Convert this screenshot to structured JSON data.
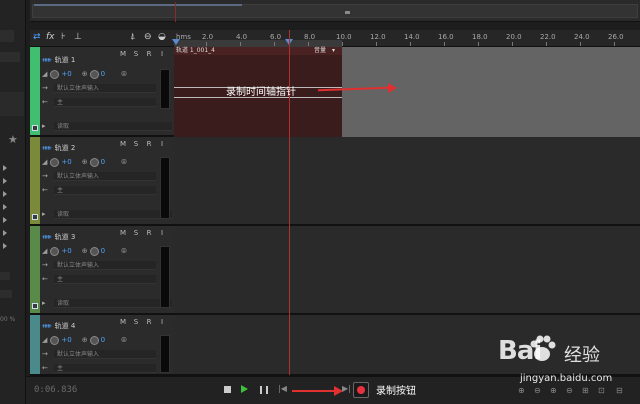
{
  "left_panel": {
    "percent_label": "00 %"
  },
  "toolbar": {
    "fx_label": "fx"
  },
  "ruler": {
    "unit": "hms",
    "ticks": [
      "2.0",
      "4.0",
      "6.0",
      "8.0",
      "10.0",
      "12.0",
      "14.0",
      "16.0",
      "18.0",
      "20.0",
      "22.0",
      "24.0",
      "26.0"
    ]
  },
  "track_labels": {
    "mute": "M",
    "solo": "S",
    "record": "R",
    "input": "I",
    "volume_value": "+0",
    "pan_value": "0",
    "input_placeholder": "默认立体声输入",
    "output": "主",
    "read_mode": "读取"
  },
  "tracks": [
    {
      "name": "轨道 1",
      "color": "#3fbf6f"
    },
    {
      "name": "轨道 2",
      "color": "#7a8a3a"
    },
    {
      "name": "轨道 3",
      "color": "#5a8a4a"
    },
    {
      "name": "轨道 4",
      "color": "#4a8a8a"
    }
  ],
  "clip": {
    "name": "轨道 1_001_4",
    "label": "音量"
  },
  "annotations": {
    "timeline_pointer": "录制时间轴指针",
    "record_button": "录制按钮"
  },
  "transport": {
    "time": "0:06.836"
  },
  "watermark": {
    "logo_left": "Bai",
    "logo_right": "经验",
    "url": "jingyan.baidu.com"
  },
  "colors": {
    "playhead": "#b03030",
    "record": "#e83040",
    "annotation": "#e03030",
    "clip": "#3a1c1c"
  }
}
